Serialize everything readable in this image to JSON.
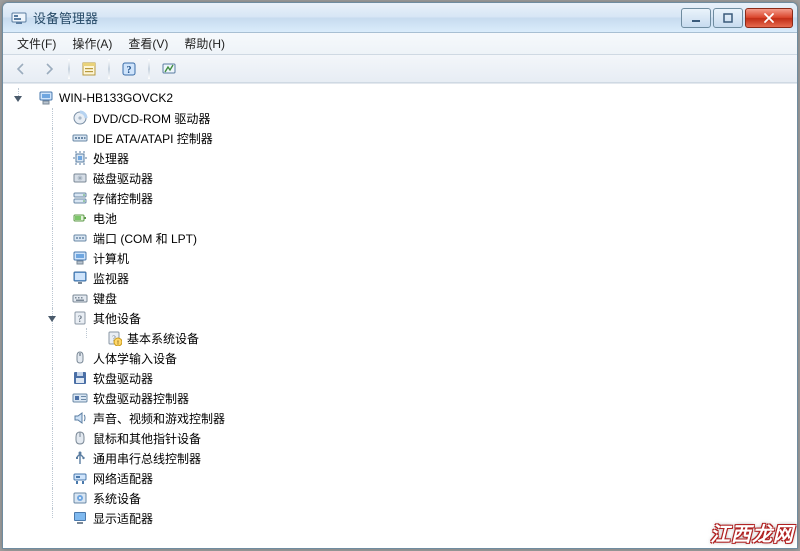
{
  "title": "设备管理器",
  "menu": [
    {
      "label": "文件(F)"
    },
    {
      "label": "操作(A)"
    },
    {
      "label": "查看(V)"
    },
    {
      "label": "帮助(H)"
    }
  ],
  "toolbar": {
    "back": {
      "name": "back-button",
      "icon": "arrow-left-icon",
      "disabled": true
    },
    "forward": {
      "name": "forward-button",
      "icon": "arrow-right-icon",
      "disabled": true
    },
    "props": {
      "name": "properties-button",
      "icon": "properties-icon"
    },
    "help": {
      "name": "help-button",
      "icon": "help-icon"
    },
    "scan": {
      "name": "scan-button",
      "icon": "scan-icon"
    }
  },
  "tree": {
    "expanded": true,
    "icon": "computer-icon",
    "label": "WIN-HB133GOVCK2",
    "children": [
      {
        "icon": "disc-icon",
        "label": "DVD/CD-ROM 驱动器"
      },
      {
        "icon": "ide-icon",
        "label": "IDE ATA/ATAPI 控制器"
      },
      {
        "icon": "cpu-icon",
        "label": "处理器"
      },
      {
        "icon": "disk-icon",
        "label": "磁盘驱动器"
      },
      {
        "icon": "storage-icon",
        "label": "存储控制器"
      },
      {
        "icon": "battery-icon",
        "label": "电池"
      },
      {
        "icon": "port-icon",
        "label": "端口 (COM 和 LPT)"
      },
      {
        "icon": "computer-icon",
        "label": "计算机"
      },
      {
        "icon": "monitor-icon",
        "label": "监视器"
      },
      {
        "icon": "keyboard-icon",
        "label": "键盘"
      },
      {
        "icon": "unknown-icon",
        "label": "其他设备",
        "expanded": true,
        "children": [
          {
            "icon": "unknown-warn-icon",
            "label": "基本系统设备",
            "leaf": true
          }
        ]
      },
      {
        "icon": "hid-icon",
        "label": "人体学输入设备"
      },
      {
        "icon": "floppy-icon",
        "label": "软盘驱动器"
      },
      {
        "icon": "floppy-ctrl-icon",
        "label": "软盘驱动器控制器"
      },
      {
        "icon": "sound-icon",
        "label": "声音、视频和游戏控制器"
      },
      {
        "icon": "mouse-icon",
        "label": "鼠标和其他指针设备"
      },
      {
        "icon": "usb-icon",
        "label": "通用串行总线控制器"
      },
      {
        "icon": "network-icon",
        "label": "网络适配器"
      },
      {
        "icon": "system-icon",
        "label": "系统设备"
      },
      {
        "icon": "display-icon",
        "label": "显示适配器"
      }
    ]
  },
  "watermark": "江西龙网"
}
